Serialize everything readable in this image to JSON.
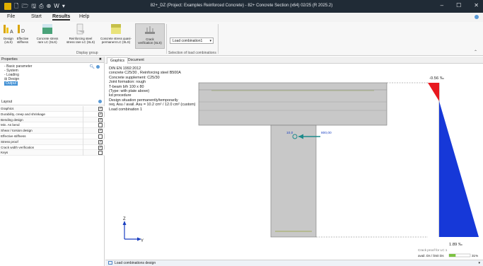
{
  "window": {
    "title": "82+_DZ (Project: Examples Reinforced Concrete) - 82+ Concrete Section (x64) 02/25 (R 2025.2)",
    "minimize": "–",
    "maximize": "☐",
    "close": "✕"
  },
  "quick_access": [
    "🗋",
    "🗁",
    "🖫",
    "⎙",
    "⊕",
    "W",
    "▾"
  ],
  "menu": {
    "tabs": [
      "File",
      "Start",
      "Results",
      "Help"
    ],
    "active": "Results"
  },
  "ribbon": {
    "buttons": [
      {
        "label_line1": "Design",
        "label_line2": "(ULS)",
        "caption": "A"
      },
      {
        "label_line1": "Effective",
        "label_line2": "stiffness",
        "caption": "D"
      },
      {
        "label_line1": "Concrete stress",
        "label_line2": "rare LC (SLS)"
      },
      {
        "label_line1": "Reinforcing steel",
        "label_line2": "stress rare LC (SLS)"
      },
      {
        "label_line1": "Concrete stress quasi-",
        "label_line2": "permanent LC (SLS)"
      },
      {
        "label_line1": "Crack",
        "label_line2": "verification (SLS)"
      }
    ],
    "group_display": "Display group",
    "group_selection": "Selection of load combinations",
    "combo_value": "Load combination1",
    "combo_arrow": "▾"
  },
  "properties": {
    "header": "Properties",
    "close": "✖",
    "tree": [
      "Basic parameter",
      "System",
      "Loading",
      "Design",
      "Output"
    ],
    "tree_prefixes": [
      "-",
      "-",
      "-",
      "⊞",
      "-"
    ],
    "selected_index": 4
  },
  "layout": {
    "header": "Layout",
    "rows": [
      {
        "label": "Graphics",
        "checked": true
      },
      {
        "label": "Durability, creep and shrinkage",
        "checked": true
      },
      {
        "label": "Bending design",
        "checked": true
      },
      {
        "label": "Min. As bend",
        "checked": false
      },
      {
        "label": "Shear / torsion design",
        "checked": true
      },
      {
        "label": "Effective stiffness",
        "checked": false
      },
      {
        "label": "Stress proof",
        "checked": true
      },
      {
        "label": "Crack width verification",
        "checked": true
      },
      {
        "label": "Keys",
        "checked": false
      }
    ]
  },
  "view_tabs": [
    "Graphics",
    "Document"
  ],
  "info_lines": [
    "DIN EN 1992:2012",
    "concrete C25/30 , Reinforcing steel B500A",
    "Concrete supplement: C25/30",
    "Joint formation: rough",
    "T-beam b/h 100 x 80",
    "(Type: with plate above)",
    "kd procedure",
    "Design situation permanently/temporarily",
    "req. Asu / avail. Asu = 10.2 cm² / 12.0 cm² (custom)",
    "Load combination 1"
  ],
  "drawing": {
    "force_label_left": "10,0",
    "force_label_right": "800,00",
    "strain_top": "-0.56 ‰",
    "strain_bottom": "1.89 ‰",
    "axis_z": "Z",
    "axis_y": "Y",
    "crack_caption": "Crack proof for LC 1",
    "crack_avail": "avail. Ds / limit Ds",
    "crack_percent": "31%",
    "crack_ratio": 0.31,
    "colors": {
      "compression": "#e8191f",
      "tension": "#1638d8",
      "section": "#c8c8c8",
      "arrow": "#1c8a8a",
      "axis": "#1a3fc0"
    }
  },
  "bottom_bar": {
    "label": "Load combinations design",
    "arrow": "▾"
  }
}
